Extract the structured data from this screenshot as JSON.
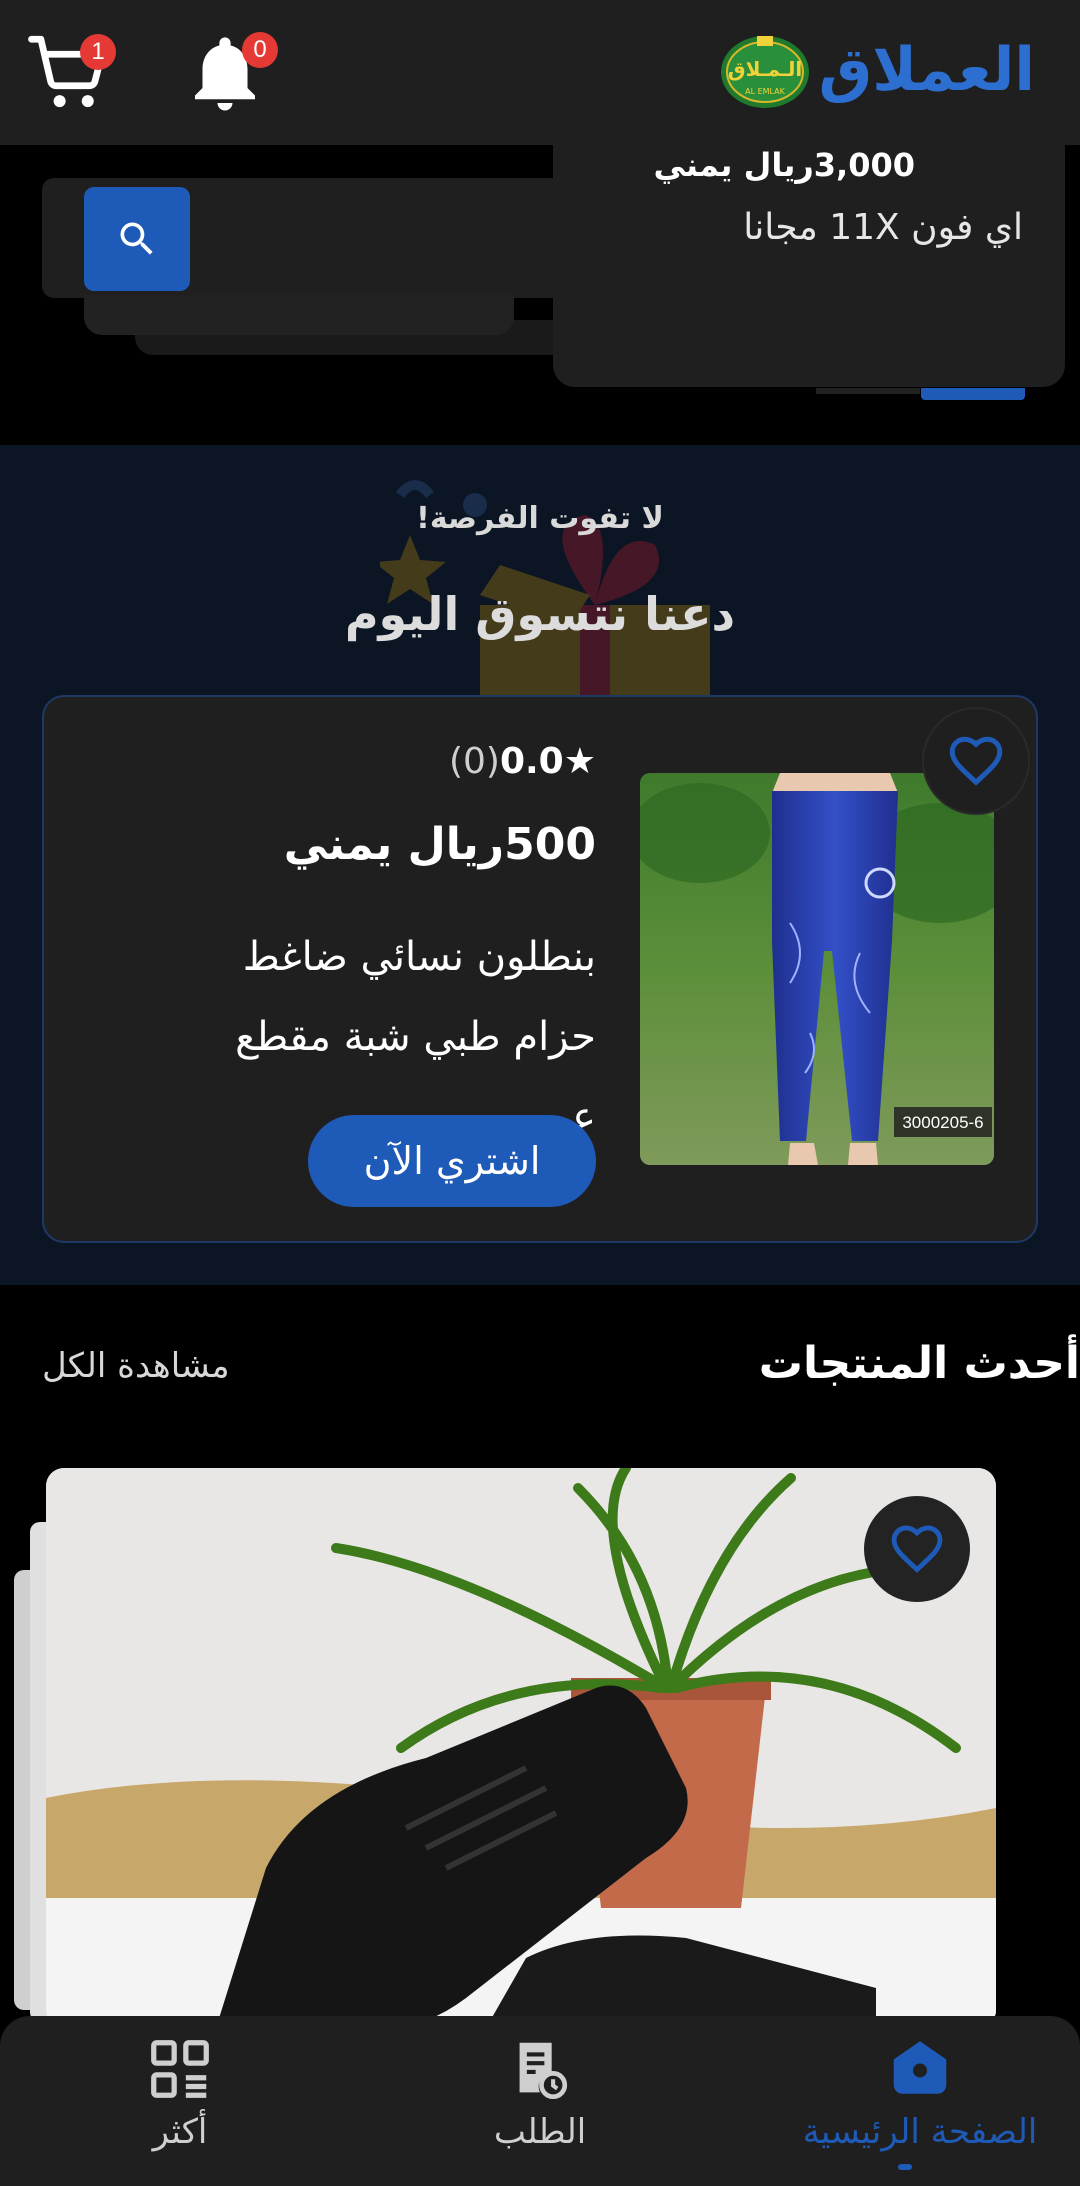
{
  "header": {
    "brand_name": "العملاق",
    "brand_logo_text": "الـمـلاق",
    "brand_logo_latin": "AL EMLAK",
    "cart_badge": "1",
    "notifications_badge": "0",
    "colors": {
      "brand": "#2c6fd1",
      "badge": "#e53935"
    }
  },
  "search": {
    "icon": "search-icon",
    "suggestion": {
      "price": "3,000ريال يمني",
      "name": "اي فون 11X مجانا"
    }
  },
  "promo": {
    "small_title": "لا تفوت الفرصة!",
    "title": "دعنا نتسوق اليوم",
    "deal": {
      "rating_value": "0.0",
      "rating_count": "(0)",
      "price": "500ريال يمني",
      "description": "بنطلون نسائي ضاغط حزام طبي شبة مقطع عر...",
      "image_code": "3000205-6",
      "buy_label": "اشتري الآن"
    }
  },
  "latest": {
    "title": "أحدث المنتجات",
    "view_all": "مشاهدة الكل"
  },
  "bottom_nav": {
    "home": "الصفحة الرئيسية",
    "orders": "الطلب",
    "more": "أكثر"
  },
  "colors": {
    "accent": "#1e5ab8",
    "background": "#000000",
    "surface": "#1f1f1f"
  }
}
